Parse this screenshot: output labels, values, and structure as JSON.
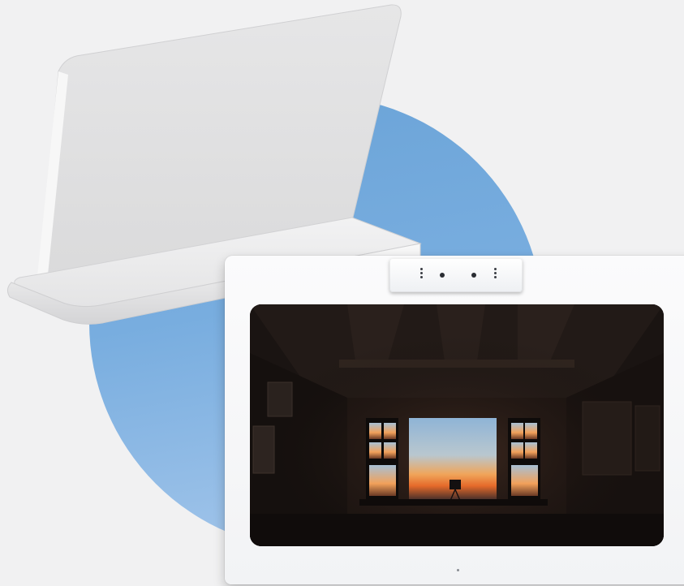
{
  "scene": {
    "description_colors": {
      "background": "#f1f1f2",
      "circle": "#78addf",
      "stand": "#e2e2e3",
      "display_frame": "#f7f7f8"
    },
    "icons": [
      "camera-icon",
      "microphone-icon",
      "status-light-icon"
    ]
  }
}
